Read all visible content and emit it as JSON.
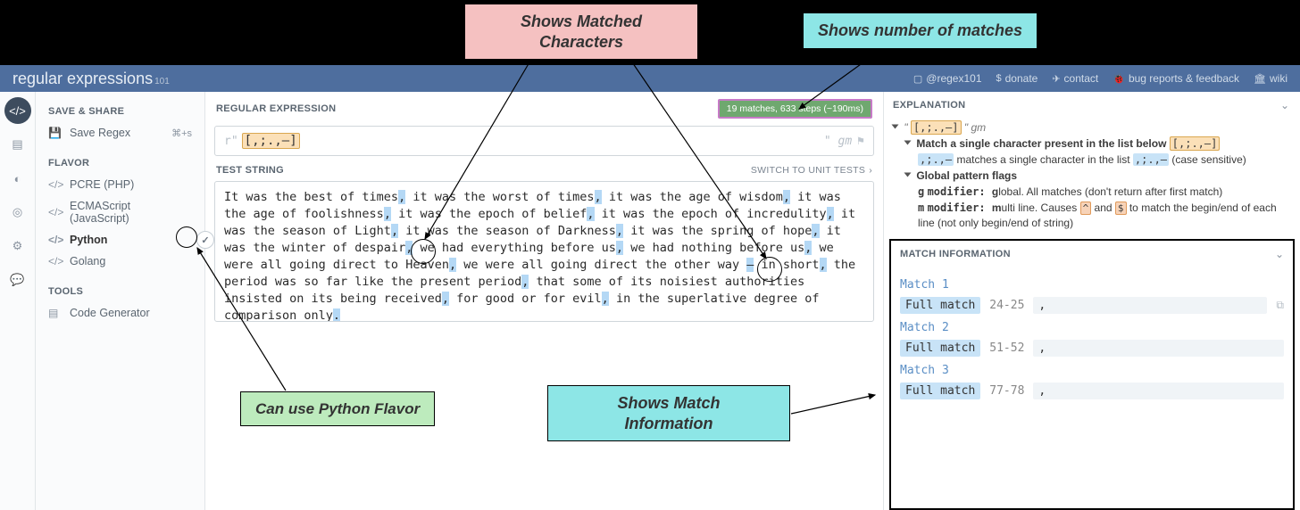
{
  "header": {
    "logo_prefix": "regular",
    "logo_suffix": " expressions",
    "logo_sub": "101",
    "nav": {
      "twitter": "@regex101",
      "donate": "donate",
      "contact": "contact",
      "bugs": "bug reports & feedback",
      "wiki": "wiki"
    }
  },
  "sidebar": {
    "save_share_title": "SAVE & SHARE",
    "save_regex": "Save Regex",
    "save_shortcut": "⌘+s",
    "flavor_title": "FLAVOR",
    "flavors": {
      "pcre": "PCRE (PHP)",
      "ecma": "ECMAScript (JavaScript)",
      "python": "Python",
      "golang": "Golang"
    },
    "tools_title": "TOOLS",
    "codegen": "Code Generator"
  },
  "center": {
    "regex_title": "REGULAR EXPRESSION",
    "match_badge": "19 matches, 633 steps (~190ms)",
    "regex_delim_prefix": "r\"",
    "regex_pattern": "[,;.,—]",
    "regex_delim_suffix": "\"",
    "regex_flags": "gm",
    "test_title": "TEST STRING",
    "switch_tests": "SWITCH TO UNIT TESTS",
    "test_string_segments": [
      {
        "t": "It was the best of times",
        "h": false
      },
      {
        "t": ",",
        "h": true
      },
      {
        "t": " it was the worst of times",
        "h": false
      },
      {
        "t": ",",
        "h": true
      },
      {
        "t": " it was the age of wisdom",
        "h": false
      },
      {
        "t": ",",
        "h": true
      },
      {
        "t": " it was the age of foolishness",
        "h": false
      },
      {
        "t": ",",
        "h": true
      },
      {
        "t": " it was the epoch of belief",
        "h": false
      },
      {
        "t": ",",
        "h": true
      },
      {
        "t": " it was the epoch of incredulity",
        "h": false
      },
      {
        "t": ",",
        "h": true
      },
      {
        "t": " it was the season of Light",
        "h": false
      },
      {
        "t": ",",
        "h": true
      },
      {
        "t": " it was the season of Darkness",
        "h": false
      },
      {
        "t": ",",
        "h": true
      },
      {
        "t": " it was the spring of hope",
        "h": false
      },
      {
        "t": ",",
        "h": true
      },
      {
        "t": " it was the winter of despair",
        "h": false
      },
      {
        "t": ",",
        "h": true
      },
      {
        "t": " we had everything before us",
        "h": false
      },
      {
        "t": ",",
        "h": true
      },
      {
        "t": " we had nothing before us",
        "h": false
      },
      {
        "t": ",",
        "h": true
      },
      {
        "t": " we were all going direct to Heaven",
        "h": false
      },
      {
        "t": ",",
        "h": true
      },
      {
        "t": " we were all going direct the other way ",
        "h": false
      },
      {
        "t": "—",
        "h": true
      },
      {
        "t": " in short",
        "h": false
      },
      {
        "t": ",",
        "h": true
      },
      {
        "t": " the period was so far like the present period",
        "h": false
      },
      {
        "t": ",",
        "h": true
      },
      {
        "t": " that some of its noisiest authorities insisted on its being received",
        "h": false
      },
      {
        "t": ",",
        "h": true
      },
      {
        "t": " for good or for evil",
        "h": false
      },
      {
        "t": ",",
        "h": true
      },
      {
        "t": " in the superlative degree of comparison only",
        "h": false
      },
      {
        "t": ".",
        "h": true
      }
    ]
  },
  "explanation": {
    "title": "EXPLANATION",
    "pattern": "[,;.,—]",
    "flags_text": "gm",
    "line_match": "Match a single character present in the list below",
    "char_list": ",;.,—",
    "char_list_desc": "matches a single character in the list",
    "case_sens": "(case sensitive)",
    "global_flags": "Global pattern flags",
    "g_mod_prefix": "g",
    "g_mod_label": "modifier:",
    "g_mod_bold": "g",
    "g_mod_rest": "lobal. All matches (don't return after first match)",
    "m_mod_prefix": "m",
    "m_mod_label": "modifier:",
    "m_mod_bold": "m",
    "m_mod_rest1": "ulti line. Causes ",
    "m_mod_rest2": " and ",
    "m_mod_rest3": " to match the begin/end of each line (not only begin/end of string)",
    "caret": "^",
    "dollar": "$"
  },
  "match_info": {
    "title": "MATCH INFORMATION",
    "matches": [
      {
        "label": "Match 1",
        "full": "Full match",
        "range": "24-25",
        "val": ","
      },
      {
        "label": "Match 2",
        "full": "Full match",
        "range": "51-52",
        "val": ","
      },
      {
        "label": "Match 3",
        "full": "Full match",
        "range": "77-78",
        "val": ","
      }
    ]
  },
  "callouts": {
    "matched_chars": "Shows Matched\nCharacters",
    "num_matches": "Shows number of matches",
    "python_flavor": "Can use Python Flavor",
    "match_info": "Shows Match\nInformation"
  }
}
